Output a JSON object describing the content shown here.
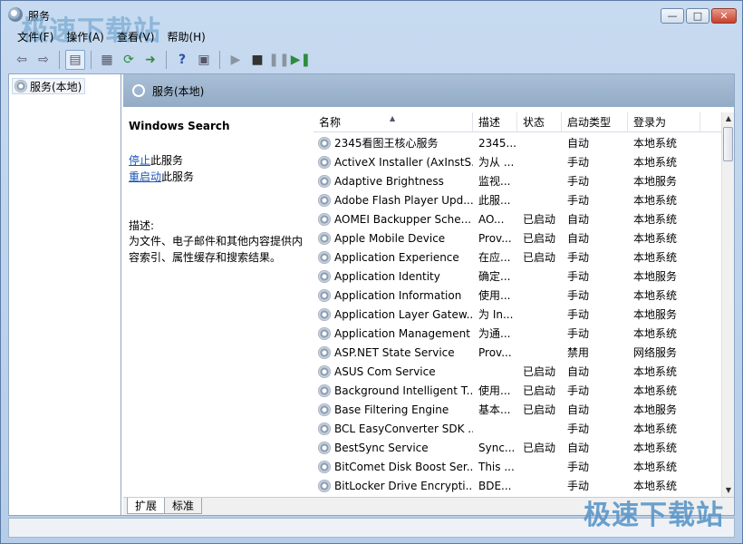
{
  "window": {
    "title": "服务"
  },
  "watermark": "极速下载站",
  "menu": [
    "文件(F)",
    "操作(A)",
    "查看(V)",
    "帮助(H)"
  ],
  "tree": {
    "root_label": "服务(本地)"
  },
  "header": {
    "title": "服务(本地)"
  },
  "description": {
    "service_name": "Windows Search",
    "stop_link": "停止",
    "stop_suffix": "此服务",
    "restart_link": "重启动",
    "restart_suffix": "此服务",
    "desc_label": "描述:",
    "desc_text": "为文件、电子邮件和其他内容提供内容索引、属性缓存和搜索结果。"
  },
  "columns": {
    "name": "名称",
    "desc": "描述",
    "status": "状态",
    "startup": "启动类型",
    "logon": "登录为"
  },
  "services": [
    {
      "name": "2345看图王核心服务",
      "desc": "2345...",
      "status": "",
      "startup": "自动",
      "logon": "本地系统"
    },
    {
      "name": "ActiveX Installer (AxInstS...",
      "desc": "为从 ...",
      "status": "",
      "startup": "手动",
      "logon": "本地系统"
    },
    {
      "name": "Adaptive Brightness",
      "desc": "监视...",
      "status": "",
      "startup": "手动",
      "logon": "本地服务"
    },
    {
      "name": "Adobe Flash Player Upd...",
      "desc": "此服...",
      "status": "",
      "startup": "手动",
      "logon": "本地系统"
    },
    {
      "name": "AOMEI Backupper Sche...",
      "desc": "AO...",
      "status": "已启动",
      "startup": "自动",
      "logon": "本地系统"
    },
    {
      "name": "Apple Mobile Device",
      "desc": "Prov...",
      "status": "已启动",
      "startup": "自动",
      "logon": "本地系统"
    },
    {
      "name": "Application Experience",
      "desc": "在应...",
      "status": "已启动",
      "startup": "手动",
      "logon": "本地系统"
    },
    {
      "name": "Application Identity",
      "desc": "确定...",
      "status": "",
      "startup": "手动",
      "logon": "本地服务"
    },
    {
      "name": "Application Information",
      "desc": "使用...",
      "status": "",
      "startup": "手动",
      "logon": "本地系统"
    },
    {
      "name": "Application Layer Gatew...",
      "desc": "为 In...",
      "status": "",
      "startup": "手动",
      "logon": "本地服务"
    },
    {
      "name": "Application Management",
      "desc": "为通...",
      "status": "",
      "startup": "手动",
      "logon": "本地系统"
    },
    {
      "name": "ASP.NET State Service",
      "desc": "Prov...",
      "status": "",
      "startup": "禁用",
      "logon": "网络服务"
    },
    {
      "name": "ASUS Com Service",
      "desc": "",
      "status": "已启动",
      "startup": "自动",
      "logon": "本地系统"
    },
    {
      "name": "Background Intelligent T...",
      "desc": "使用...",
      "status": "已启动",
      "startup": "手动",
      "logon": "本地系统"
    },
    {
      "name": "Base Filtering Engine",
      "desc": "基本...",
      "status": "已启动",
      "startup": "自动",
      "logon": "本地服务"
    },
    {
      "name": "BCL EasyConverter SDK ...",
      "desc": "",
      "status": "",
      "startup": "手动",
      "logon": "本地系统"
    },
    {
      "name": "BestSync Service",
      "desc": "Sync...",
      "status": "已启动",
      "startup": "自动",
      "logon": "本地系统"
    },
    {
      "name": "BitComet Disk Boost Ser...",
      "desc": "This ...",
      "status": "",
      "startup": "手动",
      "logon": "本地系统"
    },
    {
      "name": "BitLocker Drive Encrypti...",
      "desc": "BDE...",
      "status": "",
      "startup": "手动",
      "logon": "本地系统"
    }
  ],
  "tabs": [
    "扩展",
    "标准"
  ]
}
